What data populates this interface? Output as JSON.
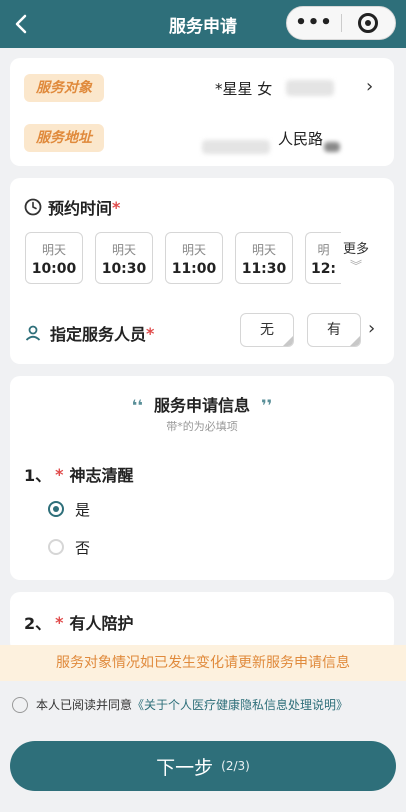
{
  "header": {
    "title": "服务申请",
    "back_icon": "chevron-left-icon",
    "menu_icon": "more-dots-icon",
    "close_icon": "target-icon"
  },
  "client": {
    "label_target": "服务对象",
    "target_value": "*星星 女",
    "label_address": "服务地址",
    "address_value": "人民路"
  },
  "appointment": {
    "title": "预约时间",
    "required_mark": "*",
    "slots": [
      {
        "day": "明天",
        "time": "10:00"
      },
      {
        "day": "明天",
        "time": "10:30"
      },
      {
        "day": "明天",
        "time": "11:00"
      },
      {
        "day": "明天",
        "time": "11:30"
      },
      {
        "day": "明",
        "time": "12:"
      }
    ],
    "more_label": "更多"
  },
  "staff": {
    "title": "指定服务人员",
    "required_mark": "*",
    "option_no": "无",
    "option_yes": "有"
  },
  "info": {
    "title": "服务申请信息",
    "subtitle": "带*的为必填项",
    "q1": {
      "number": "1、",
      "mark": "*",
      "text": "神志清醒",
      "options": [
        "是",
        "否"
      ]
    },
    "q2": {
      "number": "2、",
      "mark": "*",
      "text": "有人陪护"
    }
  },
  "notice": "服务对象情况如已发生变化请更新服务申请信息",
  "consent": {
    "prefix": "本人已阅读并同意",
    "link": "《关于个人医疗健康隐私信息处理说明》"
  },
  "next_button": {
    "label": "下一步",
    "step": "(2/3)"
  },
  "colors": {
    "primary": "#2e6f7a",
    "accent": "#e08a3c",
    "required": "#e04b4b"
  }
}
